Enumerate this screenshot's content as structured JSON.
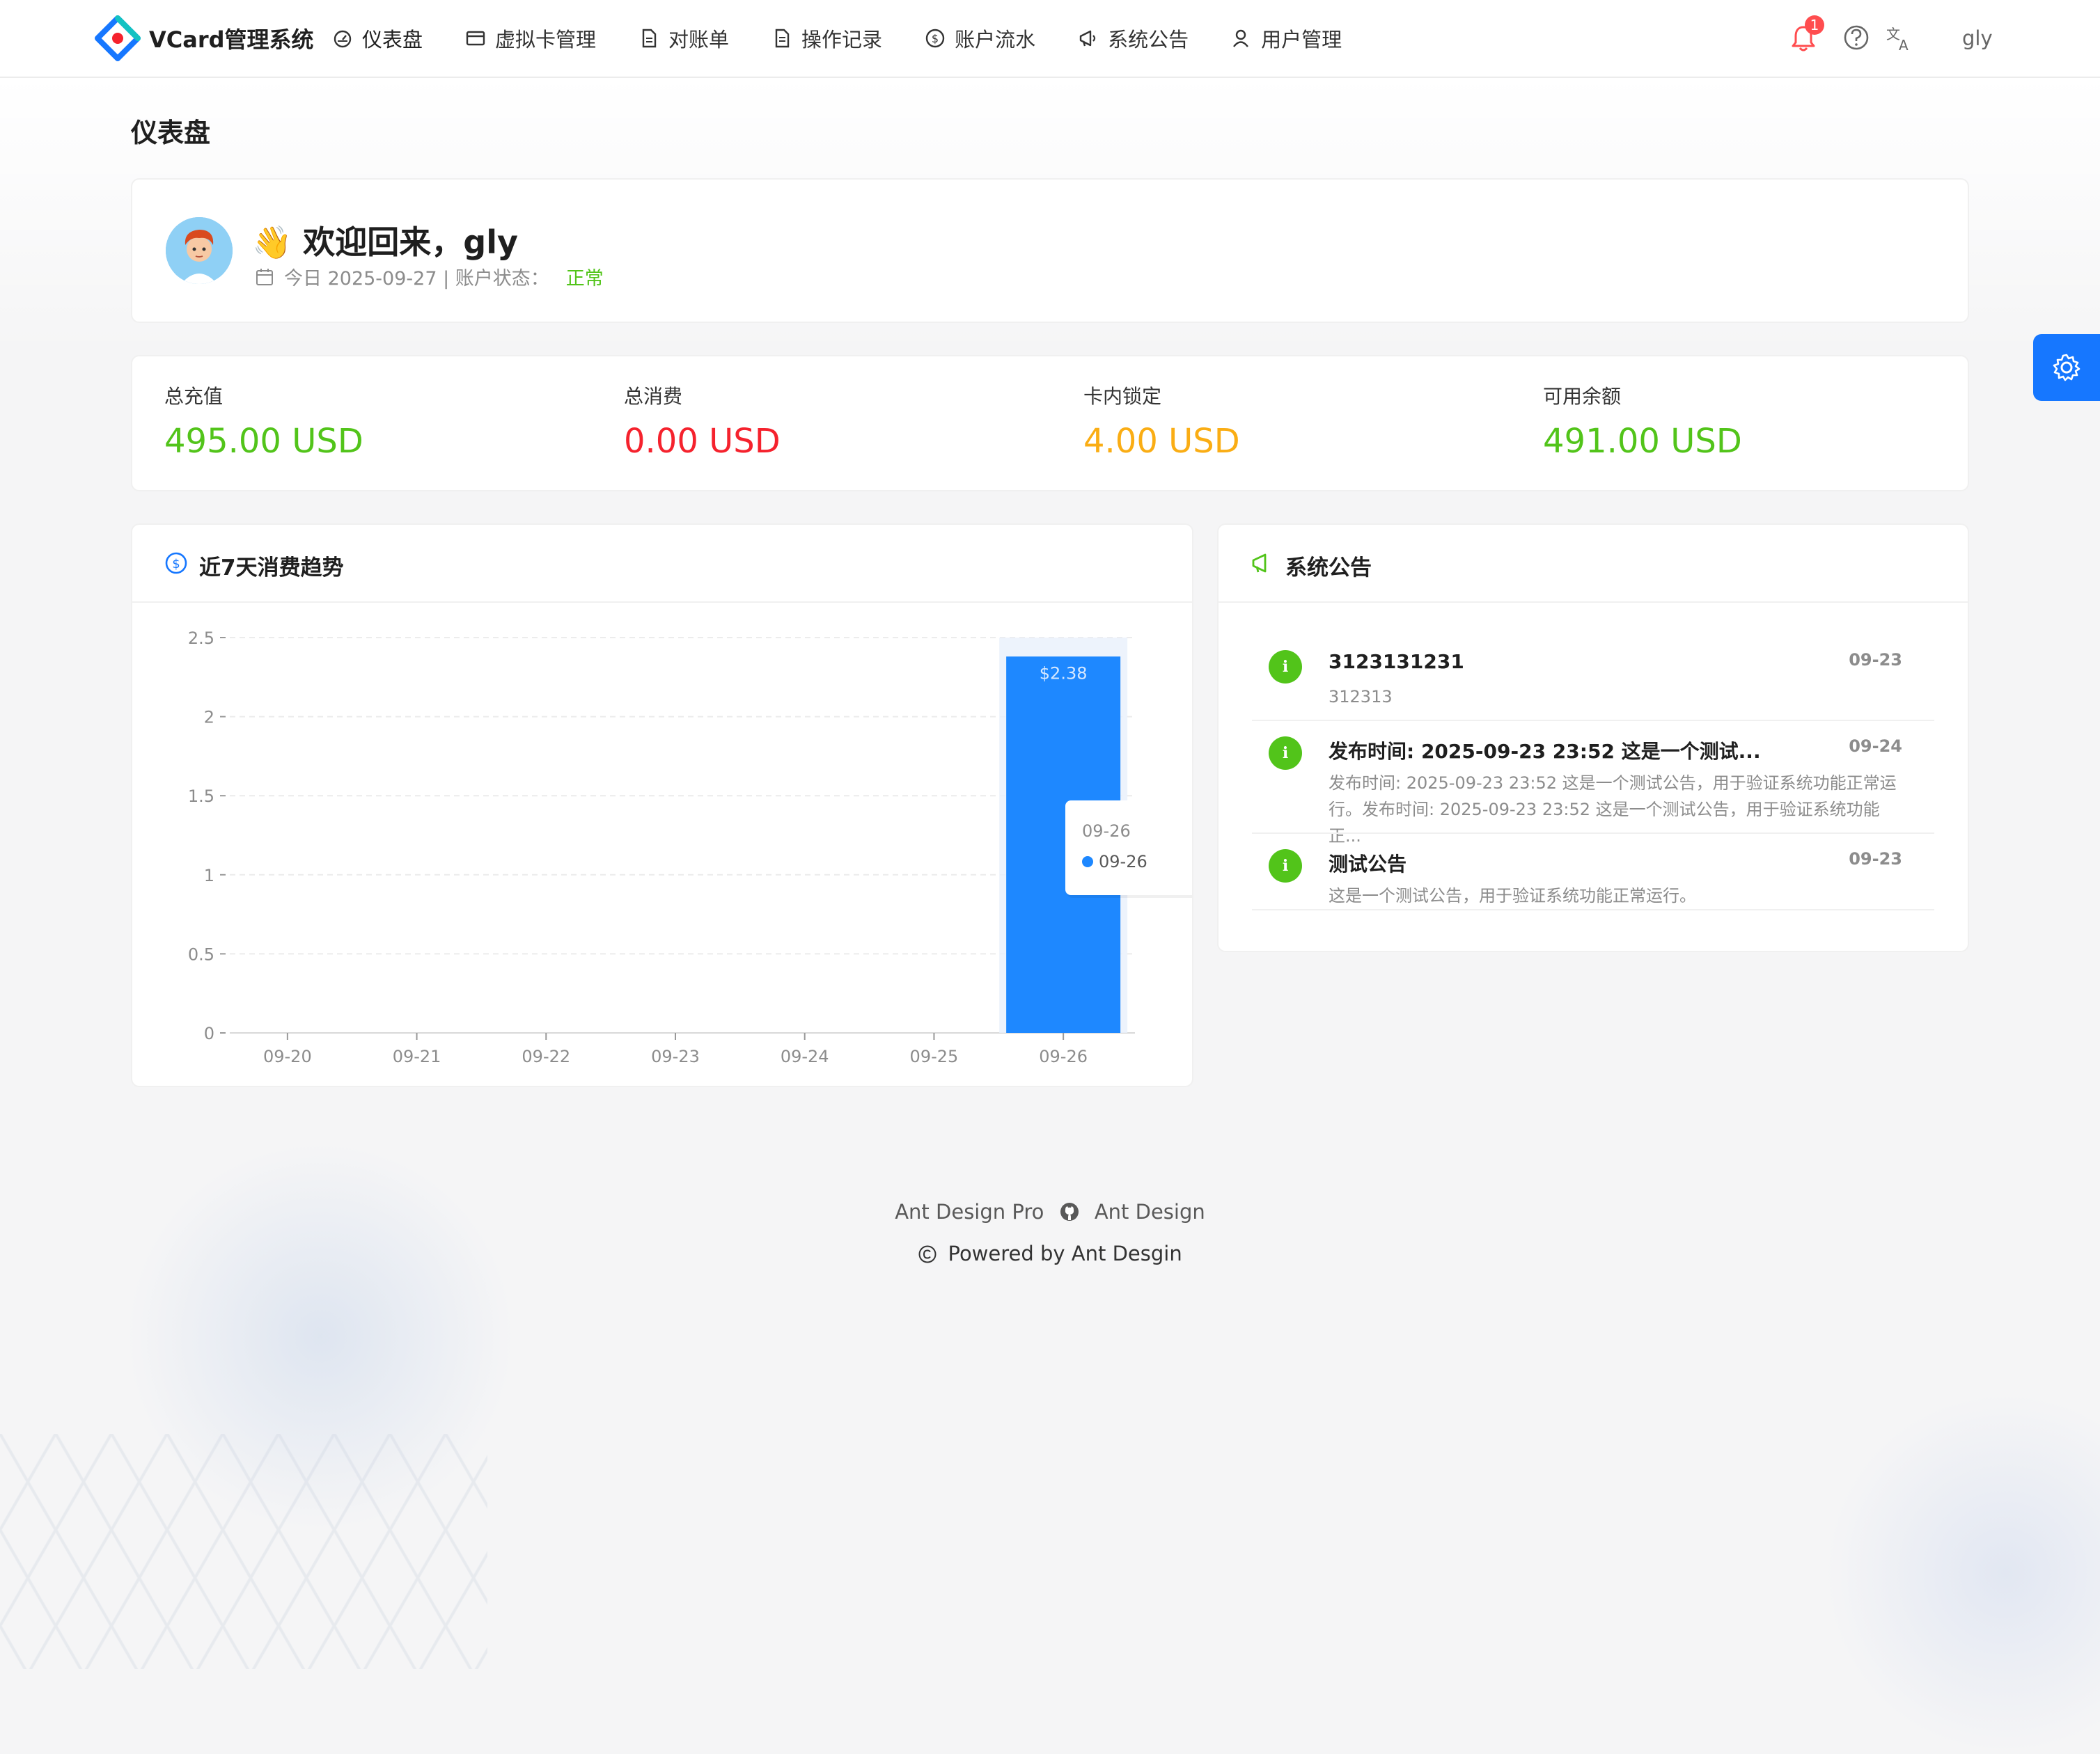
{
  "app": {
    "title": "VCard管理系统"
  },
  "nav": [
    {
      "label": "仪表盘",
      "icon": "dashboard-icon"
    },
    {
      "label": "虚拟卡管理",
      "icon": "credit-card-icon"
    },
    {
      "label": "对账单",
      "icon": "file-icon"
    },
    {
      "label": "操作记录",
      "icon": "file-text-icon"
    },
    {
      "label": "账户流水",
      "icon": "dollar-icon"
    },
    {
      "label": "系统公告",
      "icon": "megaphone-icon"
    },
    {
      "label": "用户管理",
      "icon": "user-icon"
    }
  ],
  "header": {
    "notification_count": "1",
    "username": "gly"
  },
  "page": {
    "title": "仪表盘"
  },
  "welcome": {
    "emoji": "👋",
    "greeting": "欢迎回来，gly",
    "date_text": "今日 2025-09-27 | 账户状态：",
    "status": "正常"
  },
  "stats": [
    {
      "label": "总充值",
      "value": "495.00 USD",
      "color": "#52c41a"
    },
    {
      "label": "总消费",
      "value": "0.00 USD",
      "color": "#f5222d"
    },
    {
      "label": "卡内锁定",
      "value": "4.00 USD",
      "color": "#faad14"
    },
    {
      "label": "可用余额",
      "value": "491.00 USD",
      "color": "#52c41a"
    }
  ],
  "chart_card": {
    "title": "近7天消费趋势"
  },
  "chart_data": {
    "type": "bar",
    "categories": [
      "09-20",
      "09-21",
      "09-22",
      "09-23",
      "09-24",
      "09-25",
      "09-26"
    ],
    "values": [
      0,
      0,
      0,
      0,
      0,
      0,
      2.38
    ],
    "data_labels": [
      "",
      "",
      "",
      "",
      "",
      "",
      "$2.38"
    ],
    "yticks": [
      "0",
      "0.5",
      "1",
      "1.5",
      "2",
      "2.5"
    ],
    "ylim": [
      0,
      2.5
    ],
    "bar_color": "#1e88ff",
    "tooltip": {
      "title": "09-26",
      "series": "09-26",
      "value": "null"
    }
  },
  "notices_card": {
    "title": "系统公告"
  },
  "notices": [
    {
      "title": "3123131231",
      "date": "09-23",
      "desc": "312313"
    },
    {
      "title": "发布时间: 2025-09-23 23:52 这是一个测试...",
      "date": "09-24",
      "desc": "发布时间: 2025-09-23 23:52 这是一个测试公告，用于验证系统功能正常运行。发布时间: 2025-09-23 23:52 这是一个测试公告，用于验证系统功能正..."
    },
    {
      "title": "测试公告",
      "date": "09-23",
      "desc": "这是一个测试公告，用于验证系统功能正常运行。"
    }
  ],
  "footer": {
    "link1": "Ant Design Pro",
    "link2": "Ant Design",
    "copyright": "Powered by Ant Desgin"
  }
}
